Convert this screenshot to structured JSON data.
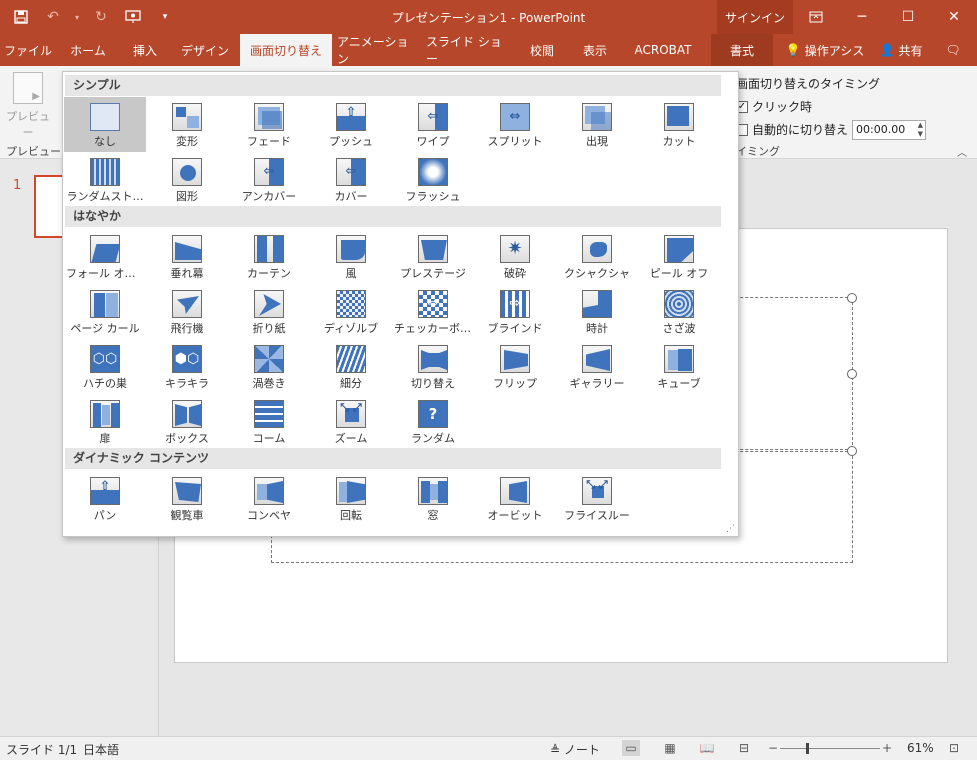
{
  "window": {
    "title": "プレゼンテーション1 - PowerPoint",
    "signin": "サインイン"
  },
  "ribbon_tabs": [
    "ファイル",
    "ホーム",
    "挿入",
    "デザイン",
    "画面切り替え",
    "アニメーション",
    "スライド ショー",
    "校閲",
    "表示",
    "ACROBAT",
    "書式"
  ],
  "ribbon_extra": {
    "tell_me": "操作アシス",
    "share": "共有"
  },
  "ribbon": {
    "preview_label": "プレビュー",
    "preview_group": "プレビュー",
    "timing_title": "画面切り替えのタイミング",
    "on_click": "クリック時",
    "auto_after": "自動的に切り替え",
    "auto_time": "00:00.00",
    "timing_group": "イミング"
  },
  "gallery": {
    "sections": [
      {
        "title": "シンプル",
        "items": [
          "なし",
          "変形",
          "フェード",
          "プッシュ",
          "ワイプ",
          "スプリット",
          "出現",
          "カット",
          "ランダムスト…",
          "図形",
          "アンカバー",
          "カバー",
          "フラッシュ"
        ]
      },
      {
        "title": "はなやか",
        "items": [
          "フォール オー…",
          "垂れ幕",
          "カーテン",
          "風",
          "プレステージ",
          "破砕",
          "クシャクシャ",
          "ピール オフ",
          "ページ カール",
          "飛行機",
          "折り紙",
          "ディゾルブ",
          "チェッカーボード",
          "ブラインド",
          "時計",
          "さざ波",
          "ハチの巣",
          "キラキラ",
          "渦巻き",
          "細分",
          "切り替え",
          "フリップ",
          "ギャラリー",
          "キューブ",
          "扉",
          "ボックス",
          "コーム",
          "ズーム",
          "ランダム"
        ]
      },
      {
        "title": "ダイナミック コンテンツ",
        "items": [
          "パン",
          "観覧車",
          "コンベヤ",
          "回転",
          "窓",
          "オービット",
          "フライスルー"
        ]
      }
    ]
  },
  "thumbnail": {
    "slide_number": "1"
  },
  "status": {
    "slide_info": "スライド 1/1",
    "language": "日本語",
    "notes": "ノート",
    "zoom": "61%"
  },
  "colors": {
    "accent": "#b7472a",
    "selection": "#d24726",
    "icon_blue": "#3f74bd"
  }
}
